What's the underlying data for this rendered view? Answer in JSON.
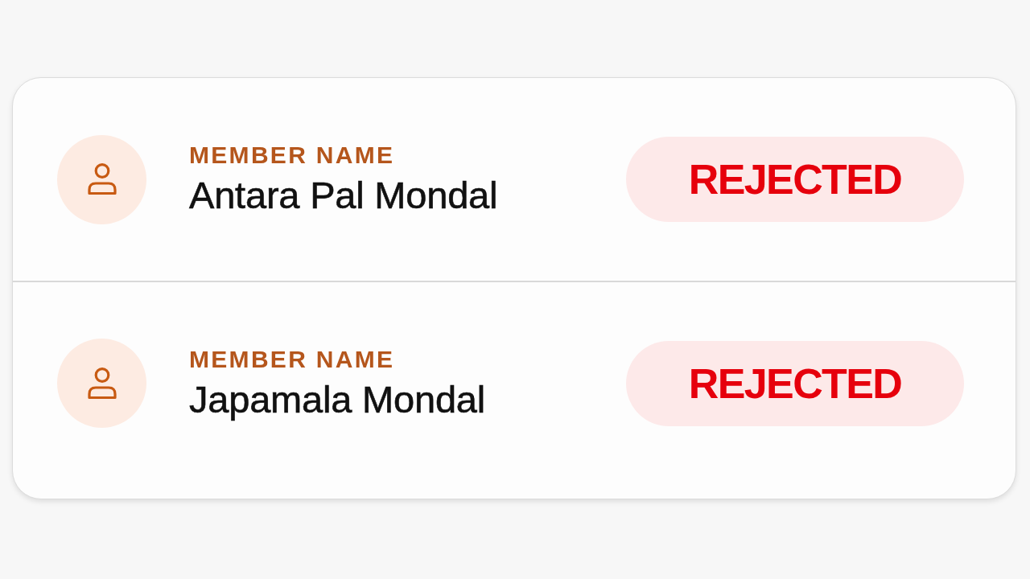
{
  "members": [
    {
      "label": "MEMBER NAME",
      "name": "Antara Pal Mondal",
      "status": {
        "text": "REJECTED",
        "kind": "rejected"
      }
    },
    {
      "label": "MEMBER NAME",
      "name": "Japamala Mondal",
      "status": {
        "text": "REJECTED",
        "kind": "rejected"
      }
    }
  ]
}
